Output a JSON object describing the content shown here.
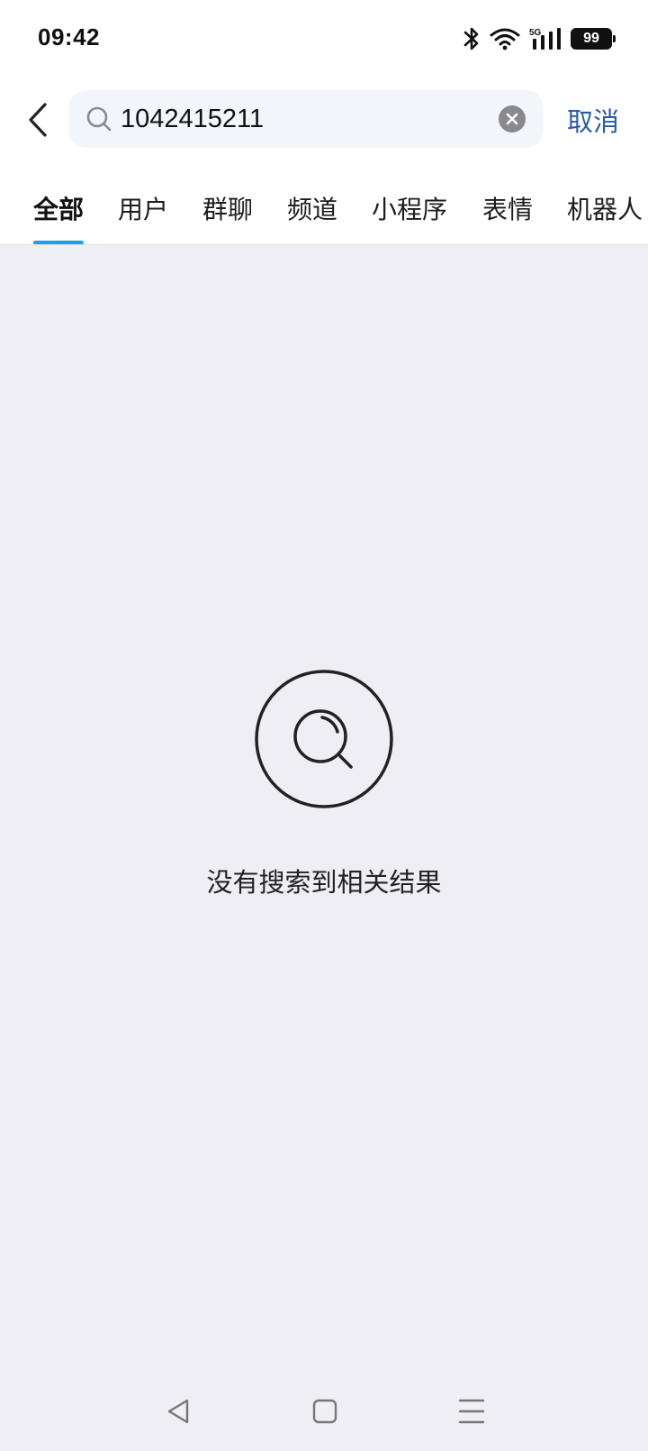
{
  "status_bar": {
    "time": "09:42",
    "network": "5G",
    "battery": "99",
    "icons": [
      "bluetooth-icon",
      "wifi-icon",
      "signal-icon",
      "battery-icon"
    ]
  },
  "search": {
    "query": "1042415211",
    "cancel_label": "取消"
  },
  "tabs": [
    {
      "label": "全部",
      "active": true
    },
    {
      "label": "用户",
      "active": false
    },
    {
      "label": "群聊",
      "active": false
    },
    {
      "label": "频道",
      "active": false
    },
    {
      "label": "小程序",
      "active": false
    },
    {
      "label": "表情",
      "active": false
    },
    {
      "label": "机器人",
      "active": false
    }
  ],
  "empty_state": {
    "message": "没有搜索到相关结果"
  },
  "nav_bar": {
    "icons": [
      "back-triangle-icon",
      "home-square-icon",
      "menu-lines-icon"
    ]
  },
  "colors": {
    "accent": "#14A2F2",
    "cancel_text": "#2C5AA7",
    "background": "#EFEFF3",
    "search_bg": "#F2F5FA"
  }
}
